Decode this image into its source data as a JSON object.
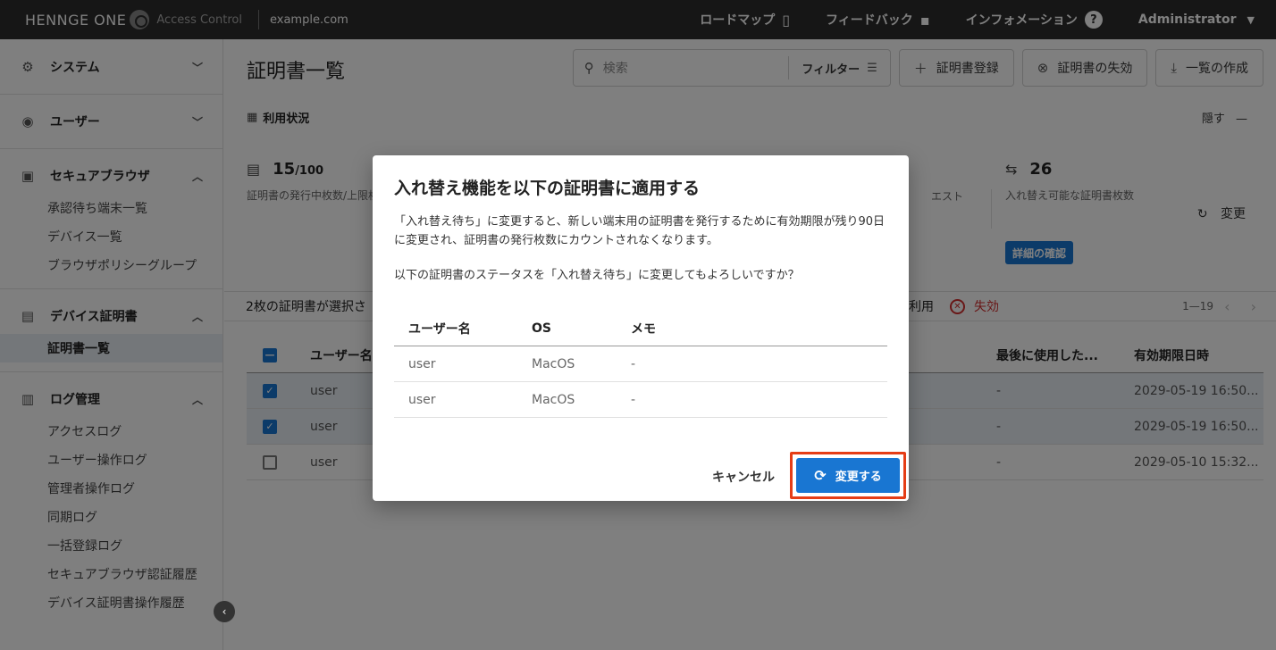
{
  "topbar": {
    "brand": "HENNGE ONE",
    "product": "Access Control",
    "domain": "example.com",
    "roadmap": "ロードマップ",
    "feedback": "フィードバック",
    "information": "インフォメーション",
    "admin": "Administrator"
  },
  "sidebar": {
    "system": "システム",
    "users": "ユーザー",
    "secure_browser": "セキュアブラウザ",
    "sb_items": [
      "承認待ち端末一覧",
      "デバイス一覧",
      "ブラウザポリシーグループ"
    ],
    "device_cert": "デバイス証明書",
    "cert_items": [
      "証明書一覧"
    ],
    "log_mgmt": "ログ管理",
    "log_items": [
      "アクセスログ",
      "ユーザー操作ログ",
      "管理者操作ログ",
      "同期ログ",
      "一括登録ログ",
      "セキュアブラウザ認証履歴",
      "デバイス証明書操作履歴"
    ]
  },
  "main": {
    "title": "証明書一覧",
    "search_placeholder": "検索",
    "filter": "フィルター",
    "register": "証明書登録",
    "revoke": "証明書の失効",
    "export": "一覧の作成",
    "usage": "利用状況",
    "hide": "隠す",
    "stat1_value": "15",
    "stat1_max": "/100",
    "stat1_label": "証明書の発行中枚数/上限枚",
    "stat_mid_label": "エスト",
    "stat2_value": "26",
    "stat2_label": "入れ替え可能な証明書枚数",
    "change": "変更",
    "detail": "詳細の確認",
    "selected_text": "2枚の証明書が選択さ",
    "use_text": "利用",
    "revoke_text": "失効",
    "pager": "1—19",
    "table": {
      "headers": [
        "ユーザー名",
        "最後に使用した...",
        "有効期限日時"
      ],
      "rows": [
        {
          "user": "user",
          "last": "-",
          "expires": "2029-05-19 16:50..."
        },
        {
          "user": "user",
          "last": "-",
          "expires": "2029-05-19 16:50..."
        },
        {
          "user": "user",
          "last": "-",
          "expires": "2029-05-10 15:32..."
        }
      ]
    }
  },
  "dialog": {
    "title": "入れ替え機能を以下の証明書に適用する",
    "body": "「入れ替え待ち」に変更すると、新しい端末用の証明書を発行するために有効期限が残り90日に変更され、証明書の発行枚数にカウントされなくなります。",
    "question": "以下の証明書のステータスを「入れ替え待ち」に変更してもよろしいですか？",
    "headers": [
      "ユーザー名",
      "OS",
      "メモ"
    ],
    "rows": [
      {
        "user": "user",
        "os": "MacOS",
        "memo": "-"
      },
      {
        "user": "user",
        "os": "MacOS",
        "memo": "-"
      }
    ],
    "cancel": "キャンセル",
    "confirm": "変更する"
  }
}
